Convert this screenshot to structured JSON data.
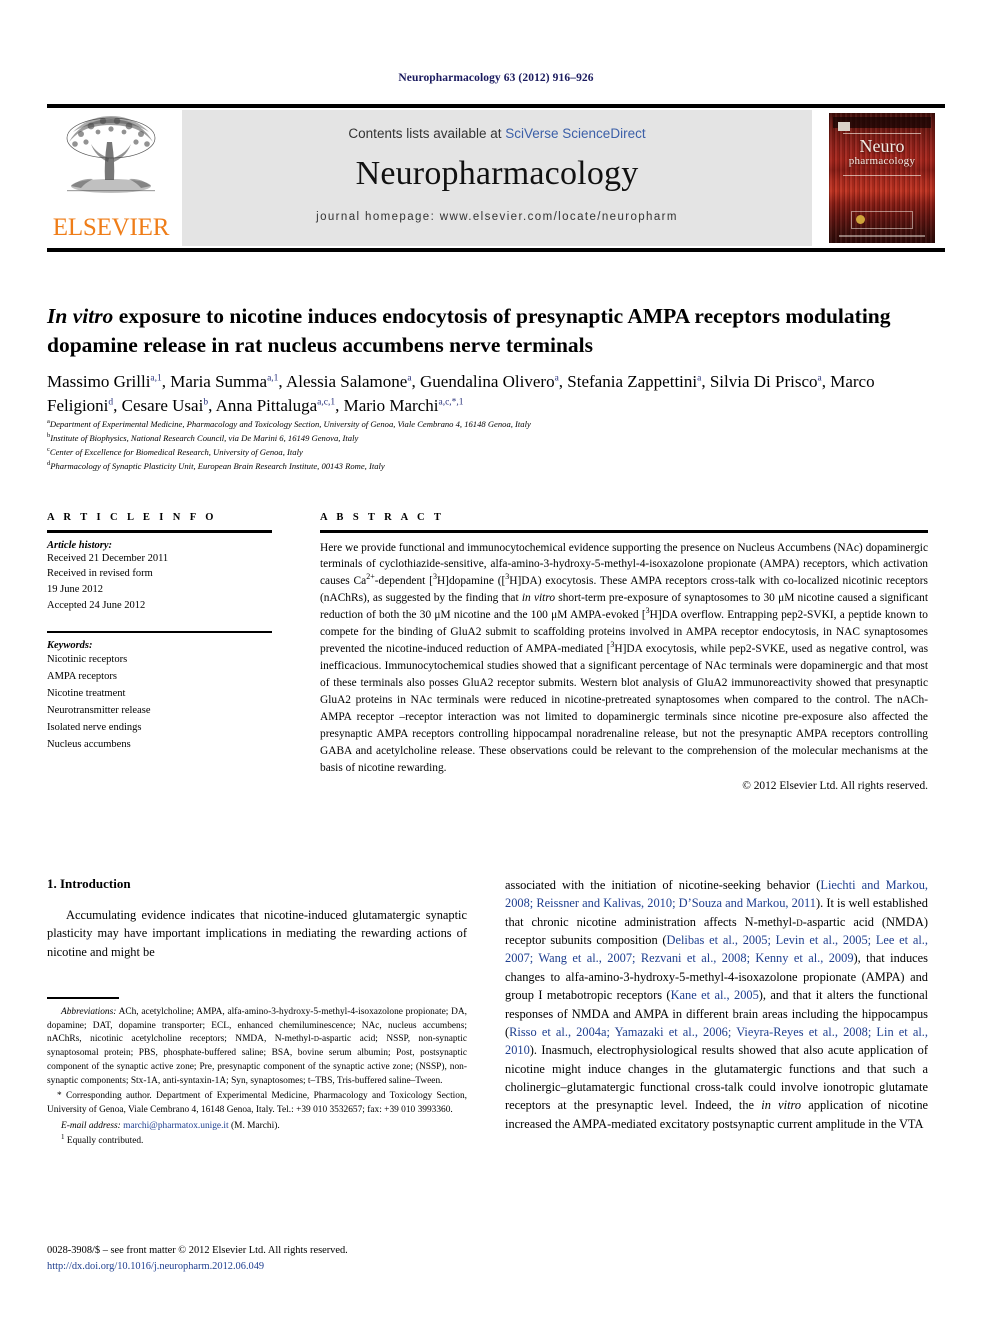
{
  "running_head": "Neuropharmacology 63 (2012) 916–926",
  "masthead": {
    "contents_prefix": "Contents lists available at ",
    "sciencedirect": "SciVerse ScienceDirect",
    "journal_name": "Neuropharmacology",
    "homepage": "journal homepage: www.elsevier.com/locate/neuropharm",
    "publisher": "ELSEVIER",
    "publisher_color": "#ef7d18",
    "link_color": "#3b5fa8",
    "cover_title_line1": "Neuro",
    "cover_title_line2": "pharmacology"
  },
  "title": {
    "italic_lead": "In vitro",
    "rest": " exposure to nicotine induces endocytosis of presynaptic AMPA receptors modulating dopamine release in rat nucleus accumbens nerve terminals"
  },
  "authors": [
    {
      "name": "Massimo Grilli",
      "sup": "a,1",
      "sep": ", "
    },
    {
      "name": "Maria Summa",
      "sup": "a,1",
      "sep": ", "
    },
    {
      "name": "Alessia Salamone",
      "sup": "a",
      "sep": ", "
    },
    {
      "name": "Guendalina Olivero",
      "sup": "a",
      "sep": ", "
    },
    {
      "name": "Stefania Zappettini",
      "sup": "a",
      "sep": ", "
    },
    {
      "name": "Silvia Di Prisco",
      "sup": "a",
      "sep": ", "
    },
    {
      "name": "Marco Feligioni",
      "sup": "d",
      "sep": ", "
    },
    {
      "name": "Cesare Usai",
      "sup": "b",
      "sep": ", "
    },
    {
      "name": "Anna Pittaluga",
      "sup": "a,c,1",
      "sep": ", "
    },
    {
      "name": "Mario Marchi",
      "sup": "a,c,*,1",
      "sep": ""
    }
  ],
  "affiliations": [
    {
      "mark": "a",
      "text": "Department of Experimental Medicine, Pharmacology and Toxicology Section, University of Genoa, Viale Cembrano 4, 16148 Genoa, Italy"
    },
    {
      "mark": "b",
      "text": "Institute of Biophysics, National Research Council, via De Marini 6, 16149 Genova, Italy"
    },
    {
      "mark": "c",
      "text": "Center of Excellence for Biomedical Research, University of Genoa, Italy"
    },
    {
      "mark": "d",
      "text": "Pharmacology of Synaptic Plasticity Unit, European Brain Research Institute, 00143 Rome, Italy"
    }
  ],
  "article_info": {
    "heading": "A R T I C L E  I N F O",
    "history_label": "Article history:",
    "history": [
      "Received 21 December 2011",
      "Received in revised form",
      "19 June 2012",
      "Accepted 24 June 2012"
    ],
    "keywords_label": "Keywords:",
    "keywords": [
      "Nicotinic receptors",
      "AMPA receptors",
      "Nicotine treatment",
      "Neurotransmitter release",
      "Isolated nerve endings",
      "Nucleus accumbens"
    ]
  },
  "abstract": {
    "heading": "A B S T R A C T",
    "copyright": "© 2012 Elsevier Ltd. All rights reserved."
  },
  "introduction": {
    "heading": "1. Introduction",
    "left_par": "Accumulating evidence indicates that nicotine-induced glutamatergic synaptic plasticity may have important implications in mediating the rewarding actions of nicotine and might be"
  },
  "footnotes": {
    "abbrev_label": "Abbreviations:",
    "corresponding": "Corresponding author. Department of Experimental Medicine, Pharmacology and Toxicology Section, University of Genoa, Viale Cembrano 4, 16148 Genoa, Italy. Tel.: +39 010 3532657; fax: +39 010 3993360.",
    "email_label": "E-mail address:",
    "email": "marchi@pharmatox.unige.it",
    "email_suffix": " (M. Marchi).",
    "equally": "Equally contributed."
  },
  "imprint": {
    "line1": "0028-3908/$ – see front matter © 2012 Elsevier Ltd. All rights reserved.",
    "doi": "http://dx.doi.org/10.1016/j.neuropharm.2012.06.049"
  }
}
